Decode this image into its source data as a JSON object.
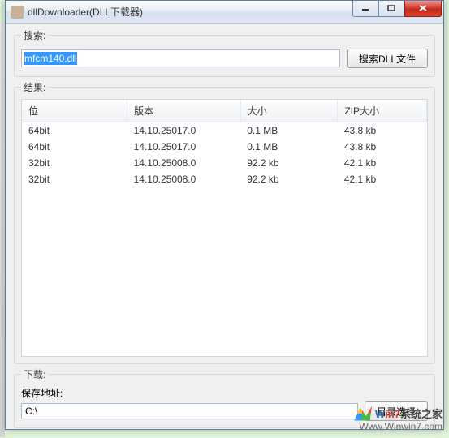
{
  "window": {
    "title": "dllDownloader(DLL下载器)"
  },
  "search": {
    "legend": "搜索:",
    "input_value": "mfcm140.dll",
    "button_label": "搜索DLL文件"
  },
  "results": {
    "legend": "结果:",
    "columns": {
      "bit": "位",
      "version": "版本",
      "size": "大小",
      "zipsize": "ZIP大小"
    },
    "rows": [
      {
        "bit": "64bit",
        "version": "14.10.25017.0",
        "size": "0.1 MB",
        "zipsize": "43.8 kb"
      },
      {
        "bit": "64bit",
        "version": "14.10.25017.0",
        "size": "0.1 MB",
        "zipsize": "43.8 kb"
      },
      {
        "bit": "32bit",
        "version": "14.10.25008.0",
        "size": "92.2 kb",
        "zipsize": "42.1 kb"
      },
      {
        "bit": "32bit",
        "version": "14.10.25008.0",
        "size": "92.2 kb",
        "zipsize": "42.1 kb"
      }
    ]
  },
  "download": {
    "legend": "下载:",
    "label": "保存地址:",
    "path": "C:\\",
    "browse_label": "目录选择"
  },
  "watermark": {
    "brand_w": "W",
    "brand_in7": "in7",
    "brand_tail": "系统之家",
    "url": "Www.Winwin7.com"
  }
}
